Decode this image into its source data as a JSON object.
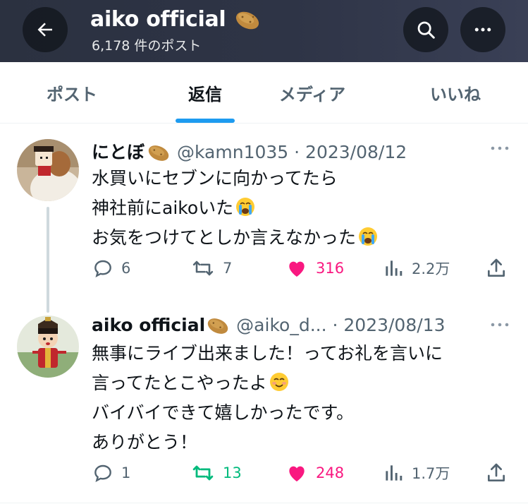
{
  "header": {
    "title": "aiko official",
    "post_count": "6,178 件のポスト",
    "title_emoji": "potato-emoji"
  },
  "tabs": [
    {
      "label": "ポスト",
      "active": false
    },
    {
      "label": "返信",
      "active": true
    },
    {
      "label": "メディア",
      "active": false
    },
    {
      "label": "いいね",
      "active": false
    }
  ],
  "tweets": [
    {
      "name": "にとぼ",
      "handle": "@kamn1035",
      "date": "· 2023/08/12",
      "lines": [
        "水買いにセブンに向かってたら",
        "神社前にaikoいた",
        "お気をつけてとしか言えなかった"
      ],
      "replies": "6",
      "retweets": "7",
      "likes": "316",
      "views": "2.2万",
      "liked": true,
      "retweeted": false
    },
    {
      "name": "aiko official",
      "handle": "@aiko_d...",
      "date": "· 2023/08/13",
      "lines": [
        "無事にライブ出来ました！ってお礼を言いに",
        "言ってたとこやったよ",
        "バイバイできて嬉しかったです。",
        "ありがとう！"
      ],
      "replies": "1",
      "retweets": "13",
      "likes": "248",
      "views": "1.7万",
      "liked": true,
      "retweeted": true
    }
  ],
  "colors": {
    "accent": "#1d9bf0",
    "like": "#f91880",
    "retweet": "#00ba7c",
    "secondary_text": "#536471"
  }
}
